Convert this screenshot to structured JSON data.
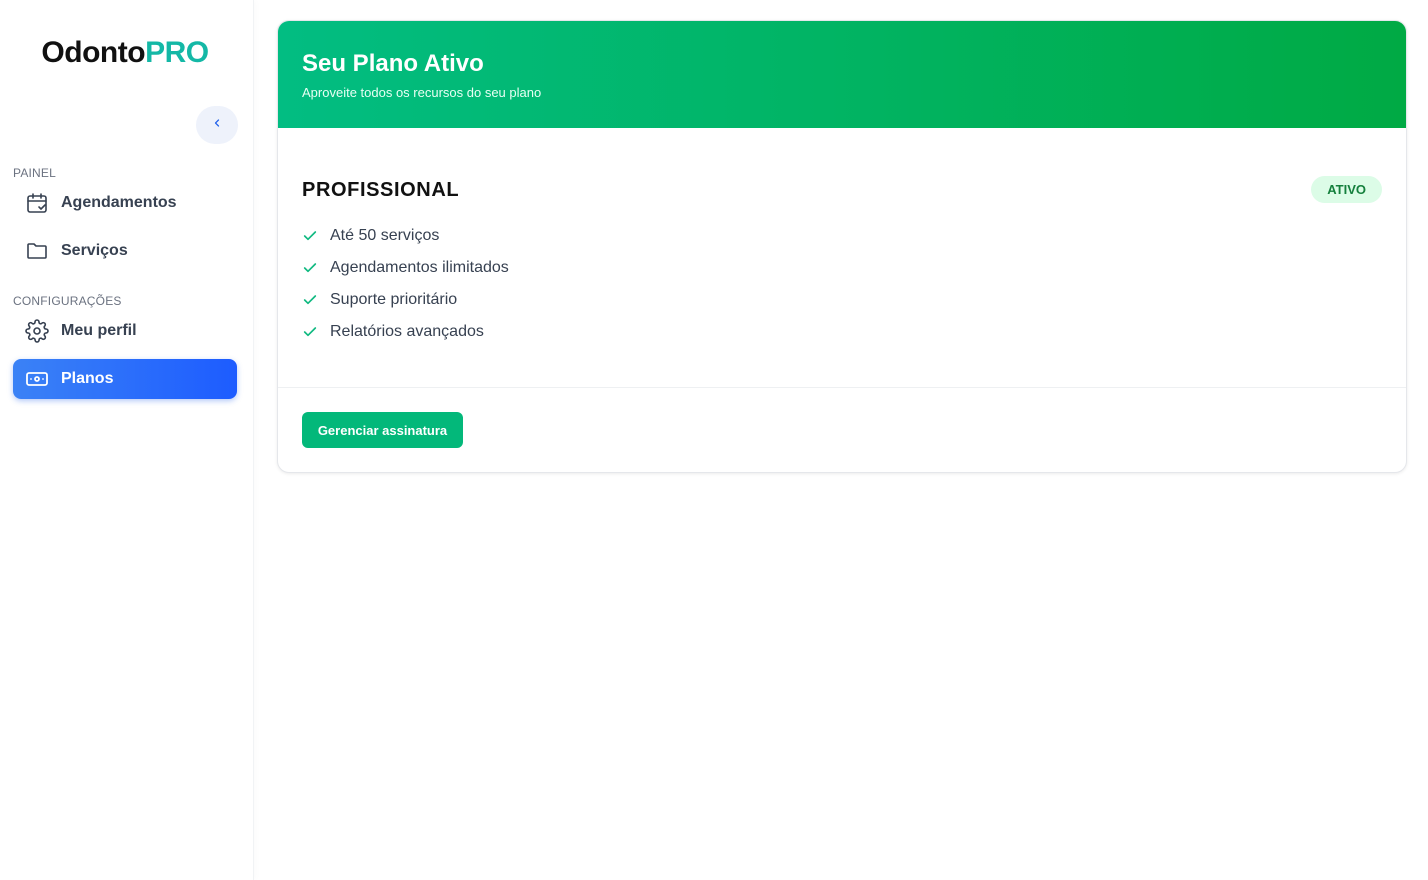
{
  "sidebar": {
    "brand": {
      "part1": "Odonto",
      "part2": "PRO"
    },
    "sections": {
      "painel": "PAINEL",
      "configuracoes": "CONFIGURAÇÕES"
    },
    "items": [
      {
        "label": "Agendamentos",
        "icon": "calendar-check-icon",
        "active": false
      },
      {
        "label": "Serviços",
        "icon": "folder-icon",
        "active": false
      },
      {
        "label": "Meu perfil",
        "icon": "gear-icon",
        "active": false
      },
      {
        "label": "Planos",
        "icon": "banknote-icon",
        "active": true
      }
    ]
  },
  "plan_card": {
    "title": "Seu Plano Ativo",
    "subtitle": "Aproveite todos os recursos do seu plano",
    "plan_name": "PROFISSIONAL",
    "status": "ATIVO",
    "features": [
      "Até 50 serviços",
      "Agendamentos ilimitados",
      "Suporte prioritário",
      "Relatórios avançados"
    ],
    "action_label": "Gerenciar assinatura"
  },
  "colors": {
    "brand_accent": "#14b8a6",
    "header_gradient_start": "#02bd82",
    "header_gradient_end": "#00aa44",
    "active_nav": "#1d5cff",
    "badge_bg": "#dcfce7",
    "badge_text": "#15803d",
    "check": "#10b981"
  }
}
